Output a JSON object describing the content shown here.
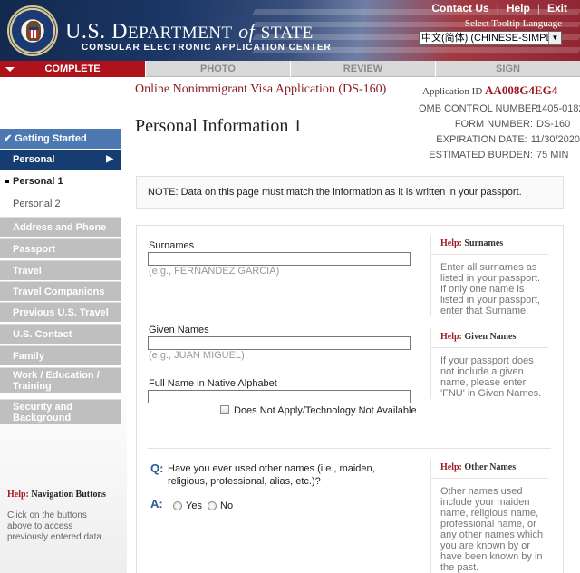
{
  "header": {
    "brand_prefix": "U.S. D",
    "brand_main": "EPARTMENT",
    "brand_of": "of",
    "brand_state": "STATE",
    "subtitle": "CONSULAR ELECTRONIC APPLICATION CENTER",
    "topnav": [
      "Contact Us",
      "Help",
      "Exit"
    ],
    "tooltip_label": "Select Tooltip Language",
    "language_value": "中文(简体)  (CHINESE-SIMPLIFIED)"
  },
  "tabs": [
    {
      "label": "COMPLETE",
      "active": true
    },
    {
      "label": "PHOTO",
      "active": false
    },
    {
      "label": "REVIEW",
      "active": false
    },
    {
      "label": "SIGN",
      "active": false
    }
  ],
  "sidebar": {
    "getting_started": "Getting Started",
    "personal": "Personal",
    "personal_1": "Personal 1",
    "personal_2": "Personal 2",
    "items": [
      "Address and Phone",
      "Passport",
      "Travel",
      "Travel Companions",
      "Previous U.S. Travel",
      "U.S. Contact",
      "Family"
    ],
    "work_education": "Work / Education / Training",
    "security": "Security and Background",
    "help_prefix": "Help:",
    "help_title": "Navigation Buttons",
    "help_text": "Click on the buttons above to access previously entered data."
  },
  "main": {
    "form_title": "Online Nonimmigrant Visa Application (DS-160)",
    "app_id_label": "Application ID",
    "app_id_value": "AA008G4EG4",
    "page_title": "Personal Information 1",
    "omb": [
      {
        "key": "OMB CONTROL NUMBER:",
        "value": "1405-0182"
      },
      {
        "key": "FORM NUMBER:",
        "value": "DS-160"
      },
      {
        "key": "EXPIRATION DATE:",
        "value": "11/30/2020"
      },
      {
        "key": "ESTIMATED BURDEN:",
        "value": "75 MIN"
      }
    ],
    "note": "NOTE: Data on this page must match the information as it is written in your passport."
  },
  "fields": {
    "surnames_label": "Surnames",
    "surnames_example": "(e.g., FERNANDEZ GARCIA)",
    "surnames_value": "",
    "given_label": "Given Names",
    "given_example": "(e.g., JUAN MIGUEL)",
    "given_value": "",
    "native_label": "Full Name in Native Alphabet",
    "native_value": "",
    "not_applicable": "Does Not Apply/Technology Not Available"
  },
  "help": {
    "prefix": "Help:",
    "surnames_title": "Surnames",
    "surnames_text": "Enter all surnames as listed in your passport. If only one name is listed in your passport, enter that Surname.",
    "given_title": "Given Names",
    "given_text": "If your passport does not include a given name, please enter 'FNU' in Given Names.",
    "other_title": "Other Names",
    "other_text": "Other names used include your maiden name, religious name, professional name, or any other names which you are known by or have been known by in the past."
  },
  "question": {
    "q_marker": "Q:",
    "a_marker": "A:",
    "text": "Have you ever used other names (i.e., maiden, religious, professional, alias, etc.)?",
    "yes": "Yes",
    "no": "No"
  }
}
